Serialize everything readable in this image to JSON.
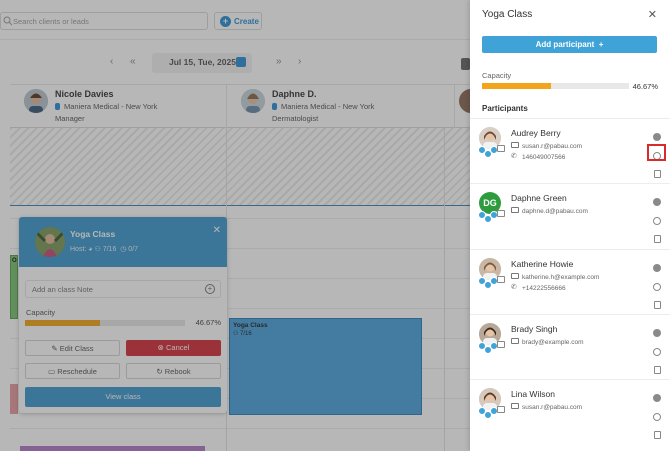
{
  "calendar": {
    "search_placeholder": "Search clients or leads",
    "create_label": "Create",
    "date_label": "Jul 15, Tue, 2025",
    "staff": [
      {
        "name": "Nicole Davies",
        "location": "Maniera Medical - New York",
        "role": "Manager"
      },
      {
        "name": "Daphne D.",
        "location": "Maniera Medical - New York",
        "role": "Dermatologist"
      }
    ],
    "events": [
      {
        "title": "Yoga Class",
        "capacity": "7/16"
      }
    ],
    "green_event_label": "O"
  },
  "popup": {
    "title": "Yoga Class",
    "host_label": "Host:",
    "capacity_a": "7/16",
    "capacity_b": "0/7",
    "note_placeholder": "Add an class Note",
    "capacity_label": "Capacity",
    "capacity_percent": "46.67%",
    "capacity_fraction": 0.4667,
    "edit_label": "Edit Class",
    "cancel_label": "Cancel",
    "reschedule_label": "Reschedule",
    "rebook_label": "Rebook",
    "view_label": "View class"
  },
  "panel": {
    "title": "Yoga Class",
    "add_participant_label": "Add participant",
    "capacity_label": "Capacity",
    "capacity_percent": "46.67%",
    "capacity_fraction": 0.4667,
    "participants_heading": "Participants",
    "participants": [
      {
        "name": "Audrey Berry",
        "email": "susan.r@pabau.com",
        "phone": "146049007566",
        "initials": "",
        "highlight": true
      },
      {
        "name": "Daphne Green",
        "email": "daphne.d@pabau.com",
        "phone": "",
        "initials": "DG",
        "highlight": false
      },
      {
        "name": "Katherine Howie",
        "email": "katherine.h@example.com",
        "phone": "+14222556666",
        "initials": "",
        "highlight": false
      },
      {
        "name": "Brady Singh",
        "email": "brady@example.com",
        "phone": "",
        "initials": "",
        "highlight": false
      },
      {
        "name": "Lina Wilson",
        "email": "susan.r@pabau.com",
        "phone": "",
        "initials": "",
        "highlight": false
      }
    ]
  },
  "colors": {
    "accent": "#3fa3d8",
    "capacity_fill": "#f2a51a",
    "cancel": "#d3303b",
    "initials_avatar": "#2e9b3f",
    "highlight": "#d82b2b"
  }
}
